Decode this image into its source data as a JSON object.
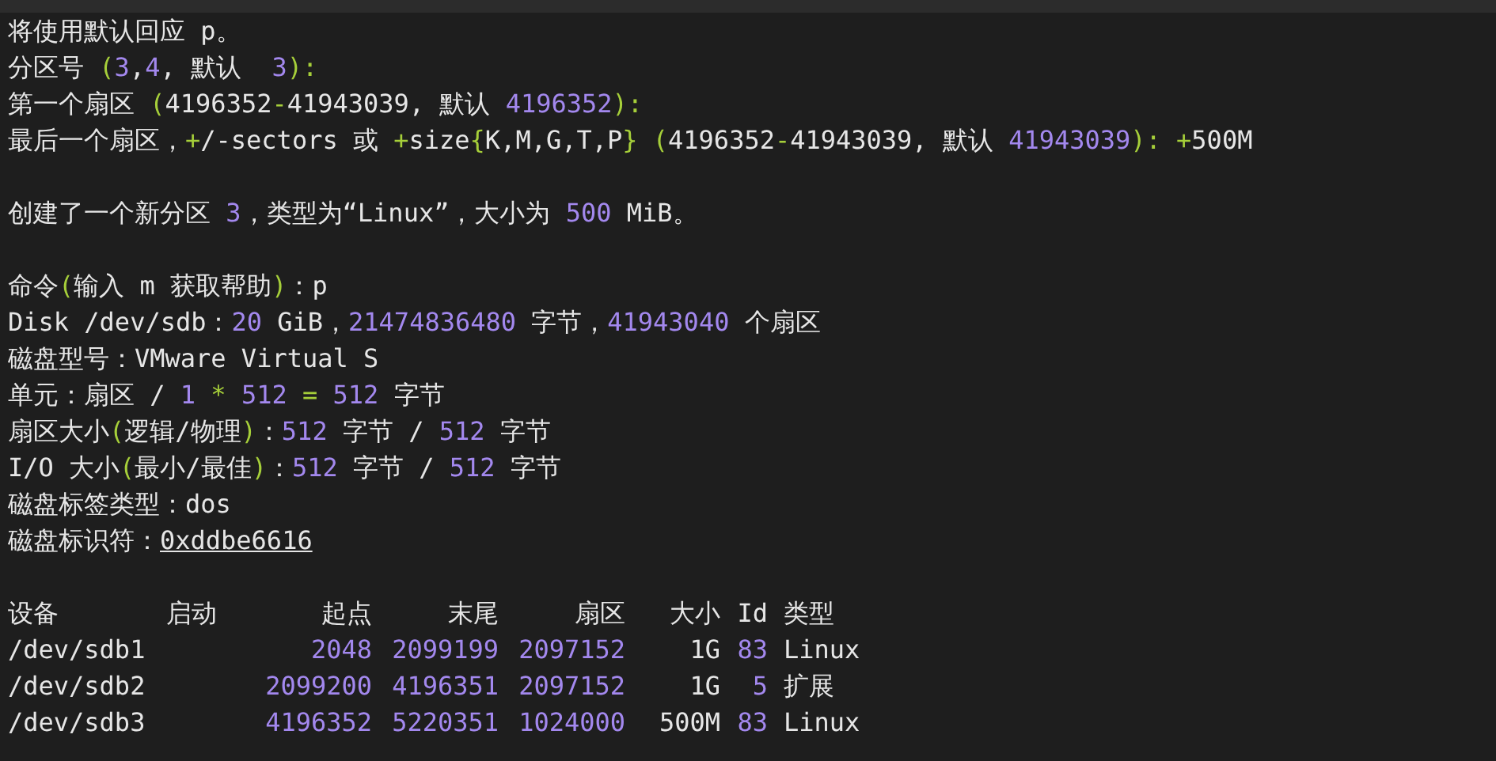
{
  "terminal": {
    "lines": [
      {
        "kind": "text",
        "segments": [
          {
            "kind": "text",
            "text": "将使用默认回应 p。"
          }
        ]
      },
      {
        "kind": "text",
        "segments": [
          {
            "kind": "text",
            "text": "分区号 "
          },
          {
            "kind": "sym",
            "text": "("
          },
          {
            "kind": "num",
            "text": "3"
          },
          {
            "kind": "text",
            "text": ","
          },
          {
            "kind": "num",
            "text": "4"
          },
          {
            "kind": "text",
            "text": ", 默认  "
          },
          {
            "kind": "num",
            "text": "3"
          },
          {
            "kind": "sym",
            "text": "):"
          }
        ]
      },
      {
        "kind": "text",
        "segments": [
          {
            "kind": "text",
            "text": "第一个扇区 "
          },
          {
            "kind": "sym",
            "text": "("
          },
          {
            "kind": "text",
            "text": "4196352"
          },
          {
            "kind": "sym",
            "text": "-"
          },
          {
            "kind": "text",
            "text": "41943039, 默认 "
          },
          {
            "kind": "num",
            "text": "4196352"
          },
          {
            "kind": "sym",
            "text": "):"
          }
        ]
      },
      {
        "kind": "text",
        "segments": [
          {
            "kind": "text",
            "text": "最后一个扇区，"
          },
          {
            "kind": "sym",
            "text": "+"
          },
          {
            "kind": "text",
            "text": "/-sectors 或 "
          },
          {
            "kind": "sym",
            "text": "+"
          },
          {
            "kind": "text",
            "text": "size"
          },
          {
            "kind": "sym",
            "text": "{"
          },
          {
            "kind": "text",
            "text": "K,M,G,T,P"
          },
          {
            "kind": "sym",
            "text": "} ("
          },
          {
            "kind": "text",
            "text": "4196352"
          },
          {
            "kind": "sym",
            "text": "-"
          },
          {
            "kind": "text",
            "text": "41943039, 默认 "
          },
          {
            "kind": "num",
            "text": "41943039"
          },
          {
            "kind": "sym",
            "text": "): +"
          },
          {
            "kind": "text",
            "text": "500M"
          }
        ]
      },
      {
        "kind": "blank"
      },
      {
        "kind": "text",
        "segments": [
          {
            "kind": "text",
            "text": "创建了一个新分区 "
          },
          {
            "kind": "num",
            "text": "3"
          },
          {
            "kind": "text",
            "text": "，类型为“Linux”，大小为 "
          },
          {
            "kind": "num",
            "text": "500"
          },
          {
            "kind": "text",
            "text": " MiB。"
          }
        ]
      },
      {
        "kind": "blank"
      },
      {
        "kind": "text",
        "segments": [
          {
            "kind": "text",
            "text": "命令"
          },
          {
            "kind": "sym",
            "text": "("
          },
          {
            "kind": "text",
            "text": "输入 m 获取帮助"
          },
          {
            "kind": "sym",
            "text": ")"
          },
          {
            "kind": "text",
            "text": "：p"
          }
        ]
      },
      {
        "kind": "text",
        "segments": [
          {
            "kind": "text",
            "text": "Disk /dev/sdb："
          },
          {
            "kind": "num",
            "text": "20"
          },
          {
            "kind": "text",
            "text": " GiB，"
          },
          {
            "kind": "num",
            "text": "21474836480"
          },
          {
            "kind": "text",
            "text": " 字节，"
          },
          {
            "kind": "num",
            "text": "41943040"
          },
          {
            "kind": "text",
            "text": " 个扇区"
          }
        ]
      },
      {
        "kind": "text",
        "segments": [
          {
            "kind": "text",
            "text": "磁盘型号：VMware Virtual S"
          }
        ]
      },
      {
        "kind": "text",
        "segments": [
          {
            "kind": "text",
            "text": "单元：扇区 / "
          },
          {
            "kind": "num",
            "text": "1"
          },
          {
            "kind": "sym",
            "text": " * "
          },
          {
            "kind": "num",
            "text": "512"
          },
          {
            "kind": "sym",
            "text": " = "
          },
          {
            "kind": "num",
            "text": "512"
          },
          {
            "kind": "text",
            "text": " 字节"
          }
        ]
      },
      {
        "kind": "text",
        "segments": [
          {
            "kind": "text",
            "text": "扇区大小"
          },
          {
            "kind": "sym",
            "text": "("
          },
          {
            "kind": "text",
            "text": "逻辑/物理"
          },
          {
            "kind": "sym",
            "text": ")"
          },
          {
            "kind": "text",
            "text": "："
          },
          {
            "kind": "num",
            "text": "512"
          },
          {
            "kind": "text",
            "text": " 字节 / "
          },
          {
            "kind": "num",
            "text": "512"
          },
          {
            "kind": "text",
            "text": " 字节"
          }
        ]
      },
      {
        "kind": "text",
        "segments": [
          {
            "kind": "text",
            "text": "I/O 大小"
          },
          {
            "kind": "sym",
            "text": "("
          },
          {
            "kind": "text",
            "text": "最小/最佳"
          },
          {
            "kind": "sym",
            "text": ")"
          },
          {
            "kind": "text",
            "text": "："
          },
          {
            "kind": "num",
            "text": "512"
          },
          {
            "kind": "text",
            "text": " 字节 / "
          },
          {
            "kind": "num",
            "text": "512"
          },
          {
            "kind": "text",
            "text": " 字节"
          }
        ]
      },
      {
        "kind": "text",
        "segments": [
          {
            "kind": "text",
            "text": "磁盘标签类型：dos"
          }
        ]
      },
      {
        "kind": "text",
        "segments": [
          {
            "kind": "text",
            "text": "磁盘标识符："
          },
          {
            "kind": "link",
            "text": "0xddbe6616"
          }
        ]
      },
      {
        "kind": "blank"
      }
    ],
    "table": {
      "columns": [
        "设备",
        "启动",
        "起点",
        "末尾",
        "扇区",
        "大小",
        "Id",
        "类型"
      ],
      "rows": [
        [
          {
            "kind": "text",
            "text": "/dev/sdb1"
          },
          null,
          {
            "kind": "num",
            "text": "2048"
          },
          {
            "kind": "num",
            "text": "2099199"
          },
          {
            "kind": "num",
            "text": "2097152"
          },
          {
            "kind": "text",
            "text": "1G"
          },
          {
            "kind": "num",
            "text": "83"
          },
          {
            "kind": "text",
            "text": "Linux"
          }
        ],
        [
          {
            "kind": "text",
            "text": "/dev/sdb2"
          },
          null,
          {
            "kind": "num",
            "text": "2099200"
          },
          {
            "kind": "num",
            "text": "4196351"
          },
          {
            "kind": "num",
            "text": "2097152"
          },
          {
            "kind": "text",
            "text": "1G"
          },
          {
            "kind": "num",
            "text": "5"
          },
          {
            "kind": "text",
            "text": "扩展"
          }
        ],
        [
          {
            "kind": "text",
            "text": "/dev/sdb3"
          },
          null,
          {
            "kind": "num",
            "text": "4196352"
          },
          {
            "kind": "num",
            "text": "5220351"
          },
          {
            "kind": "num",
            "text": "1024000"
          },
          {
            "kind": "text",
            "text": "500M"
          },
          {
            "kind": "num",
            "text": "83"
          },
          {
            "kind": "text",
            "text": "Linux"
          }
        ]
      ]
    }
  }
}
